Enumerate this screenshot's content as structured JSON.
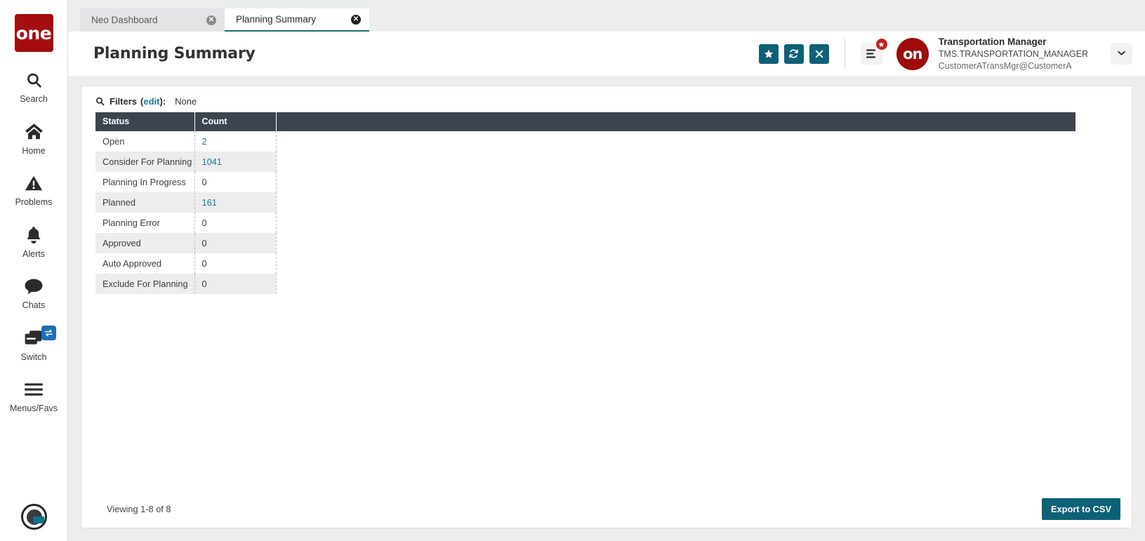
{
  "brand": {
    "logo_text": "one",
    "logo_color": "#a60d11"
  },
  "sidebar": {
    "items": [
      {
        "label": "Search",
        "icon": "search-icon"
      },
      {
        "label": "Home",
        "icon": "home-icon"
      },
      {
        "label": "Problems",
        "icon": "warning-triangle-icon"
      },
      {
        "label": "Alerts",
        "icon": "bell-icon"
      },
      {
        "label": "Chats",
        "icon": "chat-bubble-icon"
      },
      {
        "label": "Switch",
        "icon": "switch-windows-icon",
        "badge_icon": "swap-arrows-icon"
      },
      {
        "label": "Menus/Favs",
        "icon": "hamburger-icon"
      }
    ]
  },
  "tabs": [
    {
      "label": "Neo Dashboard",
      "active": false
    },
    {
      "label": "Planning Summary",
      "active": true
    }
  ],
  "header": {
    "title": "Planning Summary",
    "actions": [
      {
        "name": "favorite-button",
        "icon": "star-icon"
      },
      {
        "name": "refresh-button",
        "icon": "refresh-icon"
      },
      {
        "name": "close-button",
        "icon": "close-icon"
      }
    ],
    "menu_badge_icon": "star-icon",
    "avatar_text": "on",
    "user_name": "Transportation Manager",
    "user_role": "TMS.TRANSPORTATION_MANAGER",
    "user_email": "CustomerATransMgr@CustomerA",
    "dropdown_icon": "chevron-down-icon"
  },
  "filters": {
    "icon": "search-icon",
    "label": "Filters",
    "edit_link": "edit",
    "paren_open": "(",
    "paren_close": "):",
    "value": "None"
  },
  "table": {
    "columns": [
      "Status",
      "Count"
    ],
    "rows": [
      {
        "status": "Open",
        "count": "2",
        "link": true
      },
      {
        "status": "Consider For Planning",
        "count": "1041",
        "link": true
      },
      {
        "status": "Planning In Progress",
        "count": "0",
        "link": false
      },
      {
        "status": "Planned",
        "count": "161",
        "link": true
      },
      {
        "status": "Planning Error",
        "count": "0",
        "link": false
      },
      {
        "status": "Approved",
        "count": "0",
        "link": false
      },
      {
        "status": "Auto Approved",
        "count": "0",
        "link": false
      },
      {
        "status": "Exclude For Planning",
        "count": "0",
        "link": false
      }
    ]
  },
  "footer": {
    "viewing_text": "Viewing 1-8 of 8",
    "export_label": "Export to CSV"
  },
  "colors": {
    "accent_teal": "#0d6176",
    "link_teal": "#1b7a91",
    "brand_red": "#a60d11",
    "table_header": "#3d4450",
    "badge_red": "#c62020",
    "badge_blue": "#1d6fb8"
  }
}
